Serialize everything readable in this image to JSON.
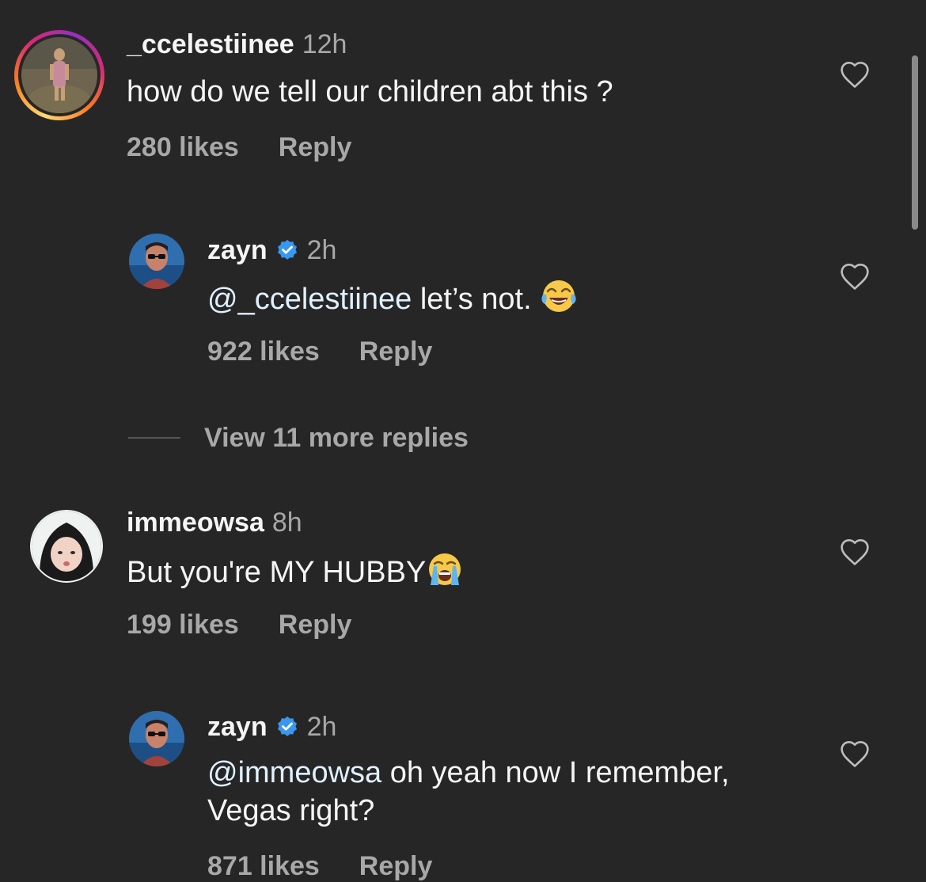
{
  "colors": {
    "background": "#262626",
    "primary_text": "#f5f5f5",
    "secondary_text": "#a8a8a8",
    "mention": "#e0f1ff",
    "verified_badge": "#3897f0"
  },
  "comments": [
    {
      "username": "_ccelestiinee",
      "time": "12h",
      "text": "how do we tell our children abt this ?",
      "likes": "280 likes",
      "reply": "Reply",
      "has_story_ring": true,
      "replies": [
        {
          "username": "zayn",
          "verified": true,
          "time": "2h",
          "mention": "@_ccelestiinee",
          "text": " let’s not. ",
          "emoji": "face-with-tears-of-joy",
          "likes": "922 likes",
          "reply": "Reply"
        }
      ],
      "view_more": "View 11 more replies"
    },
    {
      "username": "immeowsa",
      "time": "8h",
      "text": "But you're MY HUBBY",
      "emoji": "loudly-crying-face",
      "likes": "199 likes",
      "reply": "Reply",
      "replies": [
        {
          "username": "zayn",
          "verified": true,
          "time": "2h",
          "mention": "@immeowsa",
          "text": " oh yeah now I remember,",
          "text_line2": "Vegas right?",
          "likes": "871 likes",
          "reply": "Reply"
        }
      ]
    }
  ],
  "icons": {
    "like": "heart-outline-icon",
    "verified": "verified-badge-icon"
  }
}
